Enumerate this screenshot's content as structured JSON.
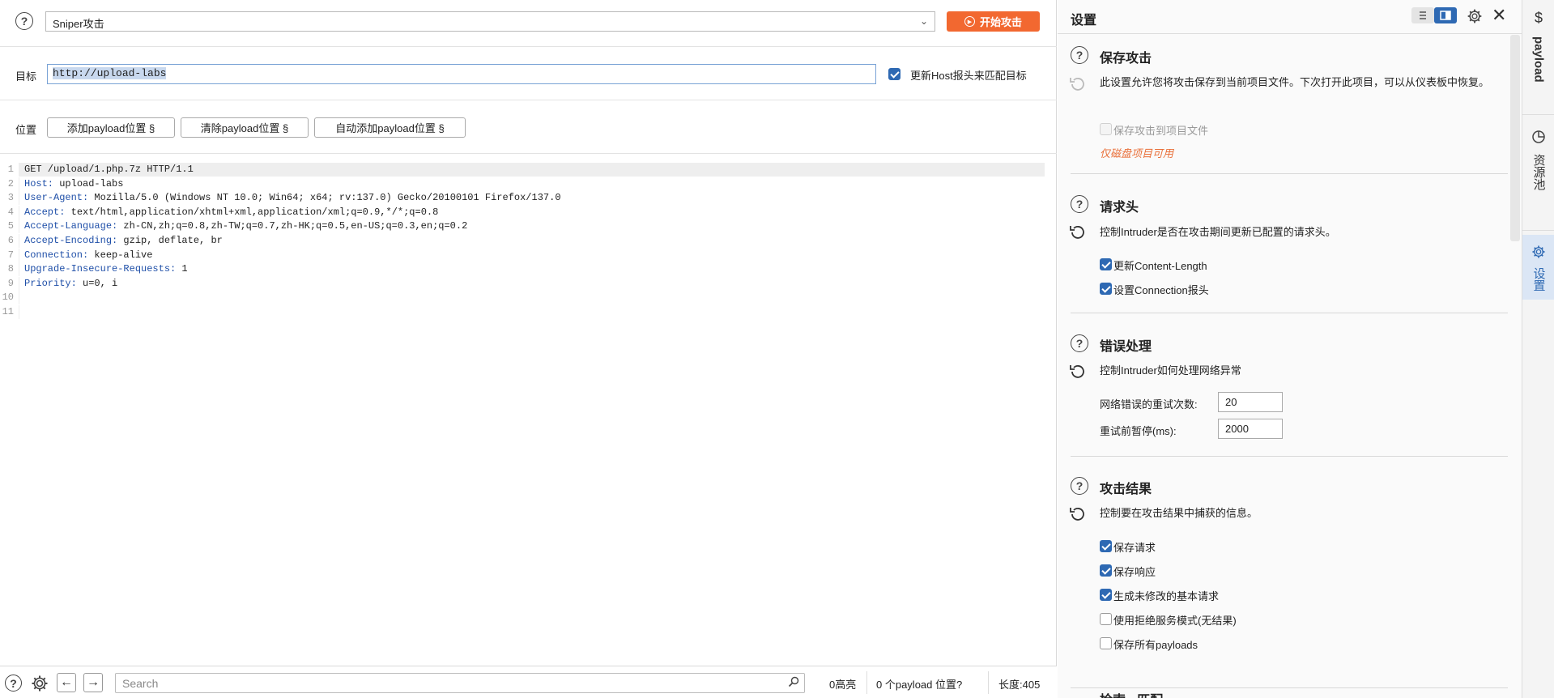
{
  "topbar": {
    "attack_type": "Sniper攻击",
    "start_button": "开始攻击"
  },
  "target": {
    "label": "目标",
    "value": "http://upload-labs",
    "update_host_label": "更新Host报头来匹配目标",
    "update_host_checked": true
  },
  "positions": {
    "label": "位置",
    "buttons": [
      "添加payload位置 §",
      "清除payload位置 §",
      "自动添加payload位置 §"
    ]
  },
  "request": {
    "lines": [
      {
        "n": "1",
        "name": "",
        "value": "GET /upload/1.php.7z HTTP/1.1"
      },
      {
        "n": "2",
        "name": "Host:",
        "value": " upload-labs"
      },
      {
        "n": "3",
        "name": "User-Agent:",
        "value": " Mozilla/5.0 (Windows NT 10.0; Win64; x64; rv:137.0) Gecko/20100101 Firefox/137.0"
      },
      {
        "n": "4",
        "name": "Accept:",
        "value": " text/html,application/xhtml+xml,application/xml;q=0.9,*/*;q=0.8"
      },
      {
        "n": "5",
        "name": "Accept-Language:",
        "value": " zh-CN,zh;q=0.8,zh-TW;q=0.7,zh-HK;q=0.5,en-US;q=0.3,en;q=0.2"
      },
      {
        "n": "6",
        "name": "Accept-Encoding:",
        "value": " gzip, deflate, br"
      },
      {
        "n": "7",
        "name": "Connection:",
        "value": " keep-alive"
      },
      {
        "n": "8",
        "name": "Upgrade-Insecure-Requests:",
        "value": " 1"
      },
      {
        "n": "9",
        "name": "Priority:",
        "value": " u=0, i"
      },
      {
        "n": "10",
        "name": "",
        "value": ""
      },
      {
        "n": "11",
        "name": "",
        "value": ""
      }
    ]
  },
  "bottombar": {
    "search_placeholder": "Search",
    "highlights": "0高亮",
    "payload_positions": "0 个payload 位置?",
    "length": "长度:405"
  },
  "settings": {
    "title": "设置",
    "save_attack": {
      "title": "保存攻击",
      "desc": "此设置允许您将攻击保存到当前项目文件。下次打开此项目，可以从仪表板中恢复。",
      "option": "保存攻击到项目文件",
      "warning": "仅磁盘项目可用"
    },
    "request_headers": {
      "title": "请求头",
      "desc": "控制Intruder是否在攻击期间更新已配置的请求头。",
      "options": [
        "更新Content-Length",
        "设置Connection报头"
      ]
    },
    "error_handling": {
      "title": "错误处理",
      "desc": "控制Intruder如何处理网络异常",
      "retries_label": "网络错误的重试次数:",
      "retries_value": "20",
      "pause_label": "重试前暂停(ms):",
      "pause_value": "2000"
    },
    "attack_results": {
      "title": "攻击结果",
      "desc": "控制要在攻击结果中捕获的信息。",
      "options": [
        {
          "label": "保存请求",
          "checked": true
        },
        {
          "label": "保存响应",
          "checked": true
        },
        {
          "label": "生成未修改的基本请求",
          "checked": true
        },
        {
          "label": "使用拒绝服务模式(无结果)",
          "checked": false
        },
        {
          "label": "保存所有payloads",
          "checked": false
        }
      ]
    },
    "next_section_title": "检索 - 匹配"
  },
  "rail": {
    "tabs": [
      "payload",
      "资源池",
      "设置"
    ]
  },
  "colors": {
    "accent": "#f26830",
    "checkbox": "#2e69b3",
    "header_name": "#1f4fa8",
    "warning": "#e9703a"
  }
}
